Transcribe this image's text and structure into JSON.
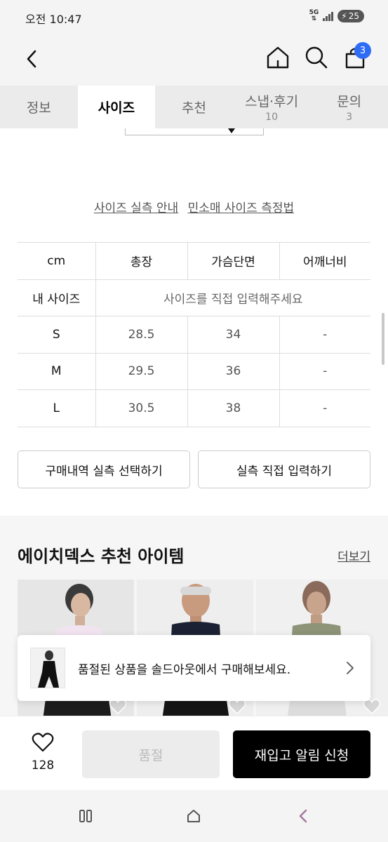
{
  "status_bar": {
    "time": "오전 10:47",
    "network_top": "5G",
    "network_bottom": "⇅",
    "battery": "25"
  },
  "header": {
    "cart_count": "3"
  },
  "tabs": [
    {
      "label": "정보",
      "count": ""
    },
    {
      "label": "사이즈",
      "count": "",
      "active": true
    },
    {
      "label": "추천",
      "count": ""
    },
    {
      "label": "스냅·후기",
      "count": "10"
    },
    {
      "label": "문의",
      "count": "3"
    }
  ],
  "size_guide": {
    "link_measure_guide": "사이즈 실측 안내",
    "link_sleeveless_method": "민소매 사이즈 측정법"
  },
  "size_table": {
    "headers": [
      "cm",
      "총장",
      "가슴단면",
      "어깨너비"
    ],
    "my_size_label": "내 사이즈",
    "my_size_hint": "사이즈를 직접 입력해주세요",
    "rows": [
      {
        "size": "S",
        "total_length": "28.5",
        "chest": "34",
        "shoulder": "-"
      },
      {
        "size": "M",
        "total_length": "29.5",
        "chest": "36",
        "shoulder": "-"
      },
      {
        "size": "L",
        "total_length": "30.5",
        "chest": "38",
        "shoulder": "-"
      }
    ]
  },
  "buttons": {
    "history_select": "구매내역 실측 선택하기",
    "direct_input": "실측 직접 입력하기"
  },
  "recommend": {
    "title": "에이치덱스 추천 아이템",
    "more": "더보기"
  },
  "toast": {
    "text": "품절된 상품을 솔드아웃에서 구매해보세요."
  },
  "bottom": {
    "like_count": "128",
    "soldout_label": "품절",
    "restock_label": "재입고 알림 신청"
  },
  "colors": {
    "badge": "#2f6cf6",
    "primary_button": "#000000",
    "disabled_button": "#ececec"
  }
}
